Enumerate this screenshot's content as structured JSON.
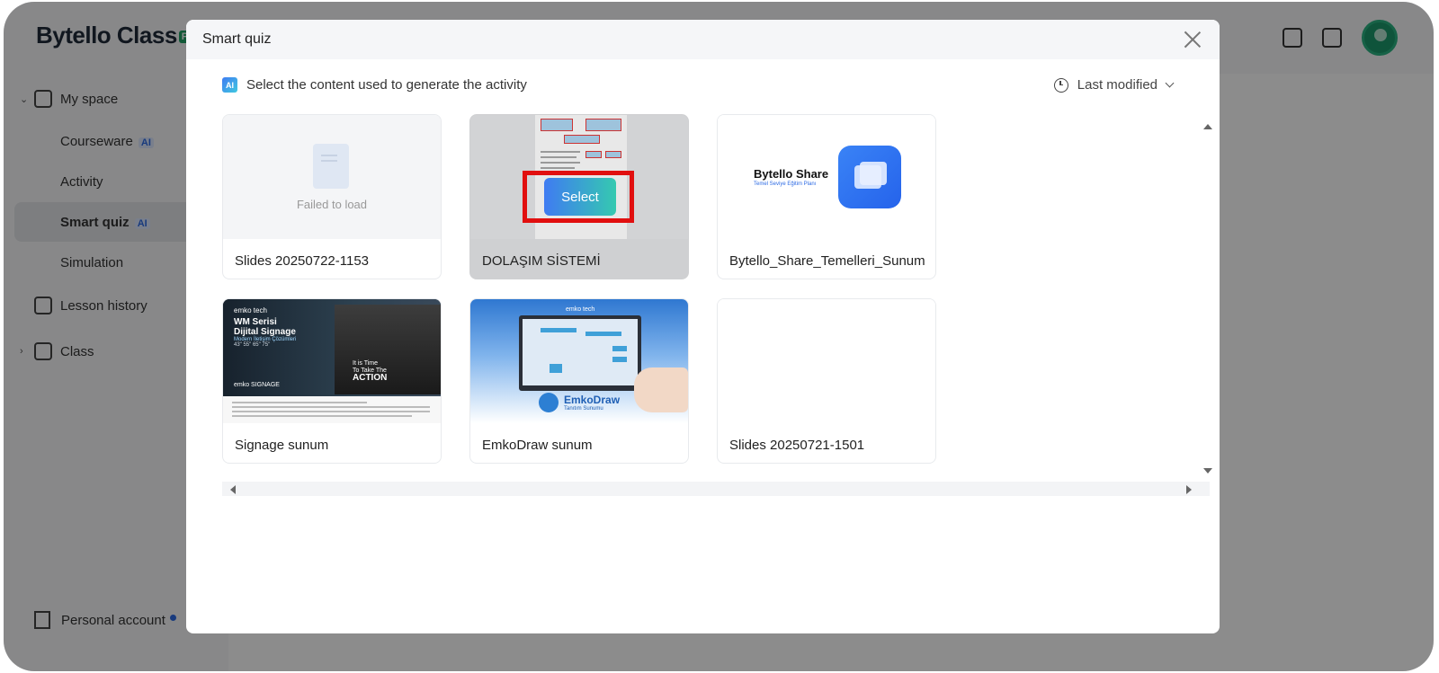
{
  "app": {
    "logo_text": "Bytello Class",
    "logo_badge": "P"
  },
  "sidebar": {
    "items": [
      {
        "label": "My space",
        "icon": "home-icon"
      },
      {
        "label": "Courseware",
        "badge": "AI"
      },
      {
        "label": "Activity"
      },
      {
        "label": "Smart quiz",
        "badge": "AI"
      },
      {
        "label": "Simulation"
      },
      {
        "label": "Lesson history",
        "icon": "lesson-history-icon"
      },
      {
        "label": "Class",
        "icon": "class-icon"
      }
    ],
    "personal_account": "Personal account"
  },
  "modal": {
    "title": "Smart quiz",
    "subheader": "Select the content used to generate the activity",
    "ai_icon_text": "AI",
    "sort_label": "Last modified",
    "select_label": "Select",
    "failed_text": "Failed to load"
  },
  "cards": [
    {
      "title": "Slides 20250722-1153"
    },
    {
      "title": "DOLAŞIM SİSTEMİ"
    },
    {
      "title": "Bytello_Share_Temelleri_Sunum"
    },
    {
      "title": "Signage sunum"
    },
    {
      "title": "EmkoDraw sunum"
    },
    {
      "title": "Slides 20250721-1501"
    }
  ],
  "thumbs": {
    "share_title": "Bytello Share",
    "share_sub": "Temel Seviye Eğitim Planı",
    "signage_brand": "emko tech",
    "signage_h1a": "WM Serisi",
    "signage_h1b": "Dijital Signage",
    "signage_sub": "Modern İletişim Çözümleri",
    "signage_sizes": "43\" 55\" 65\" 75\"",
    "signage_panel_line1": "It is Time",
    "signage_panel_line2": "To Take The",
    "signage_panel_line3": "ACTION",
    "signage_label": "emko SIGNAGE",
    "emko_brand": "emko tech",
    "emko_title": "EmkoDraw",
    "emko_sub": "Tanıtım Sunumu"
  }
}
